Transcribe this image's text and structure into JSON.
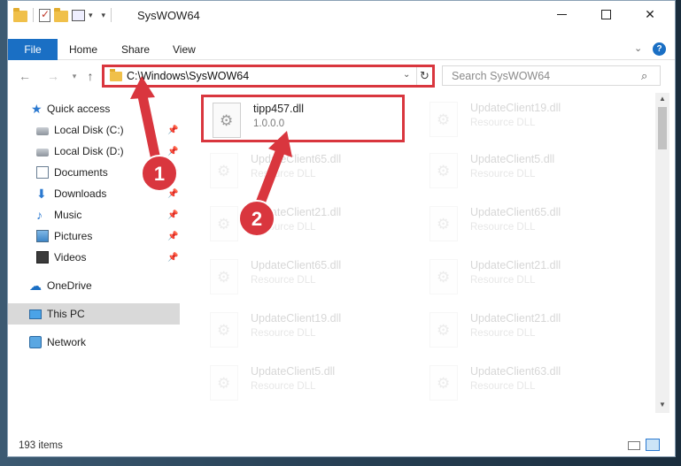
{
  "window": {
    "title": "SysWOW64"
  },
  "ribbon": {
    "tabs": [
      "File",
      "Home",
      "Share",
      "View"
    ]
  },
  "nav": {
    "address": "C:\\Windows\\SysWOW64",
    "search_placeholder": "Search SysWOW64"
  },
  "sidebar": {
    "items": [
      {
        "label": "Quick access",
        "icon": "star-icon",
        "pinned": false
      },
      {
        "label": "Local Disk (C:)",
        "icon": "drive-icon",
        "pinned": true
      },
      {
        "label": "Local Disk (D:)",
        "icon": "drive-icon",
        "pinned": true
      },
      {
        "label": "Documents",
        "icon": "documents-icon",
        "pinned": true
      },
      {
        "label": "Downloads",
        "icon": "downloads-icon",
        "pinned": true
      },
      {
        "label": "Music",
        "icon": "music-icon",
        "pinned": true
      },
      {
        "label": "Pictures",
        "icon": "pictures-icon",
        "pinned": true
      },
      {
        "label": "Videos",
        "icon": "videos-icon",
        "pinned": true
      },
      {
        "label": "OneDrive",
        "icon": "onedrive-icon",
        "pinned": false
      },
      {
        "label": "This PC",
        "icon": "this-pc-icon",
        "pinned": false,
        "selected": true
      },
      {
        "label": "Network",
        "icon": "network-icon",
        "pinned": false
      }
    ]
  },
  "files": {
    "highlighted": {
      "name": "tipp457.dll",
      "sub": "1.0.0.0"
    },
    "others": [
      {
        "name": "UpdateClient19.dll",
        "sub": "Resource DLL"
      },
      {
        "name": "UpdateClient65.dll",
        "sub": "Resource DLL"
      },
      {
        "name": "UpdateClient5.dll",
        "sub": "Resource DLL"
      },
      {
        "name": "UpdateClient21.dll",
        "sub": "Resource DLL"
      },
      {
        "name": "UpdateClient65.dll",
        "sub": "Resource DLL"
      },
      {
        "name": "UpdateClient65.dll",
        "sub": "Resource DLL"
      },
      {
        "name": "UpdateClient21.dll",
        "sub": "Resource DLL"
      },
      {
        "name": "UpdateClient19.dll",
        "sub": "Resource DLL"
      },
      {
        "name": "UpdateClient21.dll",
        "sub": "Resource DLL"
      },
      {
        "name": "UpdateClient5.dll",
        "sub": "Resource DLL"
      },
      {
        "name": "UpdateClient63.dll",
        "sub": "Resource DLL"
      }
    ]
  },
  "status": {
    "items": "193 items"
  },
  "annotations": {
    "badge1": "1",
    "badge2": "2",
    "color": "#d9363e"
  }
}
